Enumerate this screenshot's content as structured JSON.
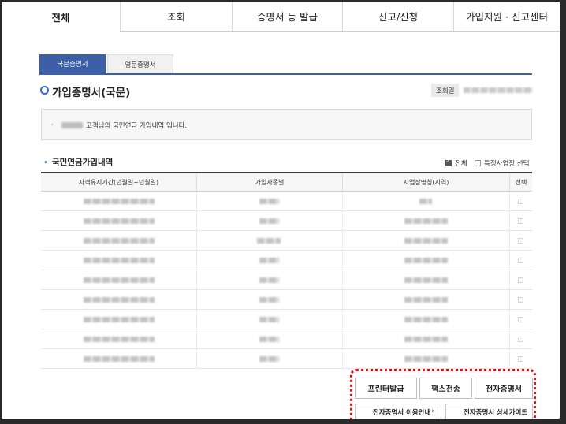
{
  "topnav": {
    "tabs": [
      {
        "label": "전체",
        "active": true
      },
      {
        "label": "조회"
      },
      {
        "label": "증명서 등 발급"
      },
      {
        "label": "신고/신청"
      },
      {
        "label": "가입지원 · 신고센터"
      }
    ]
  },
  "subtabs": {
    "korean": "국문증명서",
    "english": "영문증명서"
  },
  "page_title": "가입증명서(국문)",
  "query_date_label": "조회일",
  "info_message": "고객님의 국민연금 가입내역 입니다.",
  "section": {
    "title": "국민연금가입내역",
    "filter_all": "전체",
    "filter_specific": "특정사업장 선택"
  },
  "table": {
    "headers": [
      "자격유지기간(년월일~년월일)",
      "가입자종별",
      "사업장명칭(지역)",
      "선택"
    ],
    "row_count": 9
  },
  "buttons": {
    "print": "프린터발급",
    "fax": "팩스전송",
    "electronic": "전자증명서",
    "guide_usage": "전자증명서 이용안내",
    "guide_detail": "전자증명서 상세가이드"
  },
  "colors": {
    "accent": "#3d5fa8",
    "highlight_box": "#e0101a"
  },
  "icons": {
    "guide_chevron": "chevron-right-icon"
  }
}
